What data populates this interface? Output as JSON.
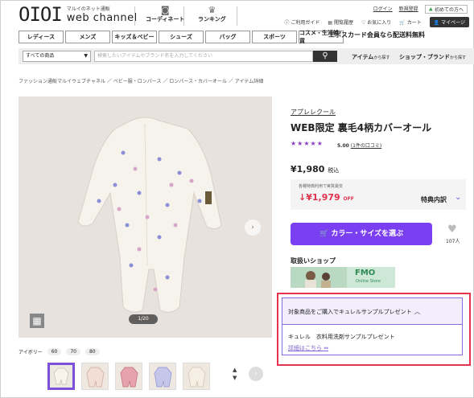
{
  "header": {
    "logo_mark": "OIOI",
    "logo_sub": "マルイのネット通販",
    "logo_main": "web channel",
    "nav": [
      {
        "label": "コーディネート",
        "icon": "camera-icon"
      },
      {
        "label": "ランキング",
        "icon": "crown-icon"
      }
    ],
    "top_links": [
      "ログイン",
      "新規登録"
    ],
    "first_time_label": "初めての方へ",
    "util": [
      {
        "label": "ご利用ガイド",
        "icon": "help-icon"
      },
      {
        "label": "閲覧履歴",
        "icon": "history-icon"
      },
      {
        "label": "お気に入り",
        "icon": "heart-icon"
      },
      {
        "label": "カート",
        "icon": "cart-icon"
      }
    ],
    "mypage_label": "マイページ"
  },
  "categories": [
    "レディース",
    "メンズ",
    "キッズ＆ベビー",
    "シューズ",
    "バッグ",
    "スポーツ",
    "コスメ・生活雑貨"
  ],
  "promo_text": "エポスカード会員なら配送料無料",
  "search": {
    "scope": "すべての商品",
    "placeholder": "検索したいアイテムやブランド名を入力してください",
    "item_link": "アイテム",
    "item_link_suffix": "から探す",
    "shop_link": "ショップ・ブランド",
    "shop_link_suffix": "から探す"
  },
  "breadcrumb": "ファッション通販マルイウェブチャネル ／ ベビー服・ロンパース ／ ロンパース・カバーオール ／ アイテム詳細",
  "gallery": {
    "counter": "1/20",
    "color_label": "アイボリー",
    "sizes": [
      "60",
      "70",
      "80"
    ]
  },
  "product": {
    "brand": "アプレレクール",
    "title": "WEB限定 裏毛4柄カバーオール",
    "stars": "★★★★★",
    "rating": "5.00",
    "reviews": "(1件の口コミ)",
    "price": "¥1,980",
    "tax": "税込",
    "member_note": "各種特典利用で実質最安",
    "off_price": "¥1,979",
    "off_suffix": "OFF",
    "benefits_label": "特典内訳",
    "cart_button": "カラー・サイズを選ぶ",
    "favorite_count": "107人",
    "shop_label": "取扱いショップ",
    "shop_logo": "FMO",
    "shop_logo_sub": "Online Store"
  },
  "campaign": {
    "header": "対象商品をご購入でキュレルサンプルプレゼント",
    "body": "キュレル　衣料用洗剤サンプルプレゼント",
    "link": "詳細はこちら"
  },
  "colors": {
    "accent": "#7b3ff2",
    "highlight": "#e8334f",
    "sale": "#e0324b"
  }
}
